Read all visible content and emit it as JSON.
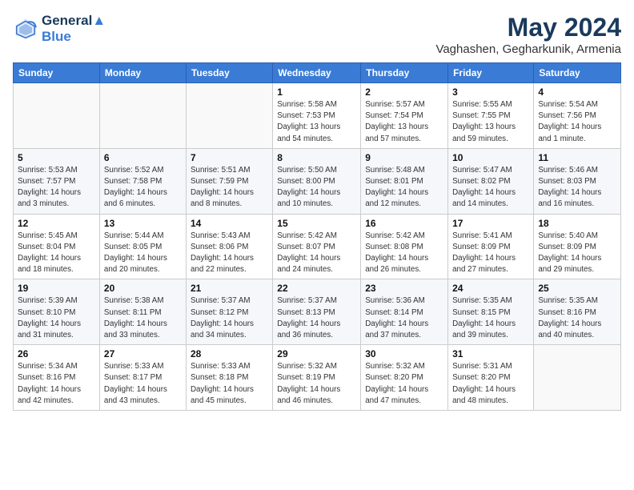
{
  "header": {
    "logo_line1": "General",
    "logo_line2": "Blue",
    "month_title": "May 2024",
    "subtitle": "Vaghashen, Gegharkunik, Armenia"
  },
  "weekdays": [
    "Sunday",
    "Monday",
    "Tuesday",
    "Wednesday",
    "Thursday",
    "Friday",
    "Saturday"
  ],
  "weeks": [
    [
      {
        "day": "",
        "info": ""
      },
      {
        "day": "",
        "info": ""
      },
      {
        "day": "",
        "info": ""
      },
      {
        "day": "1",
        "info": "Sunrise: 5:58 AM\nSunset: 7:53 PM\nDaylight: 13 hours\nand 54 minutes."
      },
      {
        "day": "2",
        "info": "Sunrise: 5:57 AM\nSunset: 7:54 PM\nDaylight: 13 hours\nand 57 minutes."
      },
      {
        "day": "3",
        "info": "Sunrise: 5:55 AM\nSunset: 7:55 PM\nDaylight: 13 hours\nand 59 minutes."
      },
      {
        "day": "4",
        "info": "Sunrise: 5:54 AM\nSunset: 7:56 PM\nDaylight: 14 hours\nand 1 minute."
      }
    ],
    [
      {
        "day": "5",
        "info": "Sunrise: 5:53 AM\nSunset: 7:57 PM\nDaylight: 14 hours\nand 3 minutes."
      },
      {
        "day": "6",
        "info": "Sunrise: 5:52 AM\nSunset: 7:58 PM\nDaylight: 14 hours\nand 6 minutes."
      },
      {
        "day": "7",
        "info": "Sunrise: 5:51 AM\nSunset: 7:59 PM\nDaylight: 14 hours\nand 8 minutes."
      },
      {
        "day": "8",
        "info": "Sunrise: 5:50 AM\nSunset: 8:00 PM\nDaylight: 14 hours\nand 10 minutes."
      },
      {
        "day": "9",
        "info": "Sunrise: 5:48 AM\nSunset: 8:01 PM\nDaylight: 14 hours\nand 12 minutes."
      },
      {
        "day": "10",
        "info": "Sunrise: 5:47 AM\nSunset: 8:02 PM\nDaylight: 14 hours\nand 14 minutes."
      },
      {
        "day": "11",
        "info": "Sunrise: 5:46 AM\nSunset: 8:03 PM\nDaylight: 14 hours\nand 16 minutes."
      }
    ],
    [
      {
        "day": "12",
        "info": "Sunrise: 5:45 AM\nSunset: 8:04 PM\nDaylight: 14 hours\nand 18 minutes."
      },
      {
        "day": "13",
        "info": "Sunrise: 5:44 AM\nSunset: 8:05 PM\nDaylight: 14 hours\nand 20 minutes."
      },
      {
        "day": "14",
        "info": "Sunrise: 5:43 AM\nSunset: 8:06 PM\nDaylight: 14 hours\nand 22 minutes."
      },
      {
        "day": "15",
        "info": "Sunrise: 5:42 AM\nSunset: 8:07 PM\nDaylight: 14 hours\nand 24 minutes."
      },
      {
        "day": "16",
        "info": "Sunrise: 5:42 AM\nSunset: 8:08 PM\nDaylight: 14 hours\nand 26 minutes."
      },
      {
        "day": "17",
        "info": "Sunrise: 5:41 AM\nSunset: 8:09 PM\nDaylight: 14 hours\nand 27 minutes."
      },
      {
        "day": "18",
        "info": "Sunrise: 5:40 AM\nSunset: 8:09 PM\nDaylight: 14 hours\nand 29 minutes."
      }
    ],
    [
      {
        "day": "19",
        "info": "Sunrise: 5:39 AM\nSunset: 8:10 PM\nDaylight: 14 hours\nand 31 minutes."
      },
      {
        "day": "20",
        "info": "Sunrise: 5:38 AM\nSunset: 8:11 PM\nDaylight: 14 hours\nand 33 minutes."
      },
      {
        "day": "21",
        "info": "Sunrise: 5:37 AM\nSunset: 8:12 PM\nDaylight: 14 hours\nand 34 minutes."
      },
      {
        "day": "22",
        "info": "Sunrise: 5:37 AM\nSunset: 8:13 PM\nDaylight: 14 hours\nand 36 minutes."
      },
      {
        "day": "23",
        "info": "Sunrise: 5:36 AM\nSunset: 8:14 PM\nDaylight: 14 hours\nand 37 minutes."
      },
      {
        "day": "24",
        "info": "Sunrise: 5:35 AM\nSunset: 8:15 PM\nDaylight: 14 hours\nand 39 minutes."
      },
      {
        "day": "25",
        "info": "Sunrise: 5:35 AM\nSunset: 8:16 PM\nDaylight: 14 hours\nand 40 minutes."
      }
    ],
    [
      {
        "day": "26",
        "info": "Sunrise: 5:34 AM\nSunset: 8:16 PM\nDaylight: 14 hours\nand 42 minutes."
      },
      {
        "day": "27",
        "info": "Sunrise: 5:33 AM\nSunset: 8:17 PM\nDaylight: 14 hours\nand 43 minutes."
      },
      {
        "day": "28",
        "info": "Sunrise: 5:33 AM\nSunset: 8:18 PM\nDaylight: 14 hours\nand 45 minutes."
      },
      {
        "day": "29",
        "info": "Sunrise: 5:32 AM\nSunset: 8:19 PM\nDaylight: 14 hours\nand 46 minutes."
      },
      {
        "day": "30",
        "info": "Sunrise: 5:32 AM\nSunset: 8:20 PM\nDaylight: 14 hours\nand 47 minutes."
      },
      {
        "day": "31",
        "info": "Sunrise: 5:31 AM\nSunset: 8:20 PM\nDaylight: 14 hours\nand 48 minutes."
      },
      {
        "day": "",
        "info": ""
      }
    ]
  ]
}
